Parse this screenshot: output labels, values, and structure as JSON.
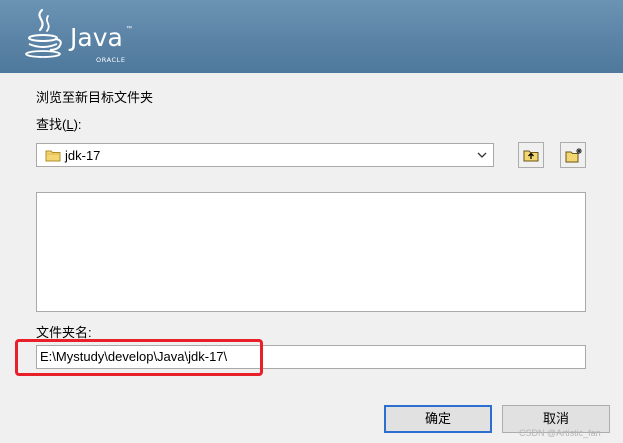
{
  "header": {
    "logo_word": "Java",
    "logo_tm": "™",
    "logo_sub": "ORACLE"
  },
  "dialog": {
    "instruction": "浏览至新目标文件夹",
    "lookin_label_prefix": "查找(",
    "lookin_label_mnemonic": "L",
    "lookin_label_suffix": "):",
    "current_folder": "jdk-17",
    "folder_name_label": "文件夹名:",
    "folder_path_value": "E:\\Mystudy\\develop\\Java\\jdk-17\\",
    "ok_label": "确定",
    "cancel_label": "取消"
  },
  "watermark": "CSDN @Artistic_fan",
  "colors": {
    "header_bg": "#5a83a6",
    "highlight": "#e8202a",
    "default_button_border": "#2d6fcf",
    "dialog_bg": "#f0f0f0"
  },
  "icons": {
    "logo": "java-cup-icon",
    "folder": "folder-icon",
    "dropdown": "chevron-down-icon",
    "up_folder": "up-one-level-icon",
    "new_folder": "new-folder-icon"
  }
}
